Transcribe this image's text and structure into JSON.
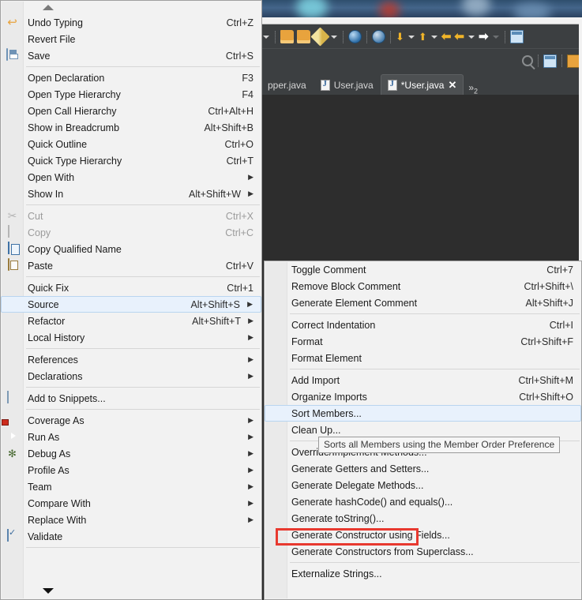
{
  "ide": {
    "toolbar_icons": [
      "folder-open-icon",
      "folder-icon",
      "pencil-icon",
      "globe-icon",
      "debug-icon",
      "download-icon",
      "upload-icon",
      "back-arrow-icon",
      "back-arrow-icon-2",
      "forward-arrow-icon",
      "new-window-icon"
    ],
    "search_icon": "search-icon",
    "tabs": [
      {
        "label": "pper.java",
        "active": false,
        "dirty": false,
        "closable": false
      },
      {
        "label": "User.java",
        "active": false,
        "dirty": false,
        "closable": false
      },
      {
        "label": "*User.java",
        "active": true,
        "dirty": true,
        "closable": true
      }
    ],
    "tab_overflow": "»",
    "tab_overflow_count": "2",
    "tab_close_glyph": "✕"
  },
  "context_menu": {
    "scroll_up": "▲",
    "scroll_down": "▼",
    "items": [
      {
        "label": "Undo Typing",
        "accel": "Ctrl+Z",
        "icon": "undo-icon",
        "type": "item"
      },
      {
        "label": "Revert File",
        "accel": "",
        "icon": "",
        "type": "item"
      },
      {
        "label": "Save",
        "accel": "Ctrl+S",
        "icon": "save-icon",
        "type": "item"
      },
      {
        "type": "separator"
      },
      {
        "label": "Open Declaration",
        "accel": "F3",
        "icon": "",
        "type": "item"
      },
      {
        "label": "Open Type Hierarchy",
        "accel": "F4",
        "icon": "",
        "type": "item"
      },
      {
        "label": "Open Call Hierarchy",
        "accel": "Ctrl+Alt+H",
        "icon": "",
        "type": "item"
      },
      {
        "label": "Show in Breadcrumb",
        "accel": "Alt+Shift+B",
        "icon": "",
        "type": "item"
      },
      {
        "label": "Quick Outline",
        "accel": "Ctrl+O",
        "icon": "",
        "type": "item"
      },
      {
        "label": "Quick Type Hierarchy",
        "accel": "Ctrl+T",
        "icon": "",
        "type": "item"
      },
      {
        "label": "Open With",
        "accel": "",
        "icon": "",
        "type": "submenu"
      },
      {
        "label": "Show In",
        "accel": "Alt+Shift+W",
        "icon": "",
        "type": "submenu"
      },
      {
        "type": "separator"
      },
      {
        "label": "Cut",
        "accel": "Ctrl+X",
        "icon": "cut-icon",
        "type": "item",
        "disabled": true
      },
      {
        "label": "Copy",
        "accel": "Ctrl+C",
        "icon": "copy-icon",
        "type": "item",
        "disabled": true
      },
      {
        "label": "Copy Qualified Name",
        "accel": "",
        "icon": "copy-qualified-icon",
        "type": "item"
      },
      {
        "label": "Paste",
        "accel": "Ctrl+V",
        "icon": "paste-icon",
        "type": "item"
      },
      {
        "type": "separator"
      },
      {
        "label": "Quick Fix",
        "accel": "Ctrl+1",
        "icon": "",
        "type": "item"
      },
      {
        "label": "Source",
        "accel": "Alt+Shift+S",
        "icon": "",
        "type": "submenu",
        "selected": true
      },
      {
        "label": "Refactor",
        "accel": "Alt+Shift+T",
        "icon": "",
        "type": "submenu"
      },
      {
        "label": "Local History",
        "accel": "",
        "icon": "",
        "type": "submenu"
      },
      {
        "type": "separator"
      },
      {
        "label": "References",
        "accel": "",
        "icon": "",
        "type": "submenu"
      },
      {
        "label": "Declarations",
        "accel": "",
        "icon": "",
        "type": "submenu"
      },
      {
        "type": "separator"
      },
      {
        "label": "Add to Snippets...",
        "accel": "",
        "icon": "snippet-icon",
        "type": "item"
      },
      {
        "type": "separator"
      },
      {
        "label": "Coverage As",
        "accel": "",
        "icon": "coverage-icon",
        "type": "submenu"
      },
      {
        "label": "Run As",
        "accel": "",
        "icon": "run-icon",
        "type": "submenu"
      },
      {
        "label": "Debug As",
        "accel": "",
        "icon": "debug-bug-icon",
        "type": "submenu"
      },
      {
        "label": "Profile As",
        "accel": "",
        "icon": "",
        "type": "submenu"
      },
      {
        "label": "Team",
        "accel": "",
        "icon": "",
        "type": "submenu"
      },
      {
        "label": "Compare With",
        "accel": "",
        "icon": "",
        "type": "submenu"
      },
      {
        "label": "Replace With",
        "accel": "",
        "icon": "",
        "type": "submenu"
      },
      {
        "label": "Validate",
        "accel": "",
        "icon": "validate-checkbox-icon",
        "type": "item"
      },
      {
        "type": "separator"
      }
    ]
  },
  "source_submenu": {
    "items": [
      {
        "label": "Toggle Comment",
        "accel": "Ctrl+7",
        "type": "item"
      },
      {
        "label": "Remove Block Comment",
        "accel": "Ctrl+Shift+\\",
        "type": "item"
      },
      {
        "label": "Generate Element Comment",
        "accel": "Alt+Shift+J",
        "type": "item"
      },
      {
        "type": "separator"
      },
      {
        "label": "Correct Indentation",
        "accel": "Ctrl+I",
        "type": "item"
      },
      {
        "label": "Format",
        "accel": "Ctrl+Shift+F",
        "type": "item"
      },
      {
        "label": "Format Element",
        "accel": "",
        "type": "item"
      },
      {
        "type": "separator"
      },
      {
        "label": "Add Import",
        "accel": "Ctrl+Shift+M",
        "type": "item"
      },
      {
        "label": "Organize Imports",
        "accel": "Ctrl+Shift+O",
        "type": "item"
      },
      {
        "label": "Sort Members...",
        "accel": "",
        "type": "item",
        "selected": true
      },
      {
        "label": "Clean Up...",
        "accel": "",
        "type": "item"
      },
      {
        "type": "separator"
      },
      {
        "label": "Override/Implement Methods...",
        "accel": "",
        "type": "item"
      },
      {
        "label": "Generate Getters and Setters...",
        "accel": "",
        "type": "item"
      },
      {
        "label": "Generate Delegate Methods...",
        "accel": "",
        "type": "item"
      },
      {
        "label": "Generate hashCode() and equals()...",
        "accel": "",
        "type": "item"
      },
      {
        "label": "Generate toString()...",
        "accel": "",
        "type": "item",
        "annotated": true
      },
      {
        "label": "Generate Constructor using Fields...",
        "accel": "",
        "type": "item"
      },
      {
        "label": "Generate Constructors from Superclass...",
        "accel": "",
        "type": "item"
      },
      {
        "type": "separator"
      },
      {
        "label": "Externalize Strings...",
        "accel": "",
        "type": "item"
      }
    ]
  },
  "tooltip": {
    "text": "Sorts all Members using the Member Order Preference"
  },
  "colors": {
    "menu_bg": "#f2f2f2",
    "menu_gutter": "#eaeaea",
    "selection_bg": "#e8f1fc",
    "selection_border": "#b9d5f0",
    "editor_bg": "#2d2d2d",
    "toolbar_bg": "#3c3f41",
    "annotation_red": "#e8392f",
    "disabled_text": "#9b9b9b"
  }
}
